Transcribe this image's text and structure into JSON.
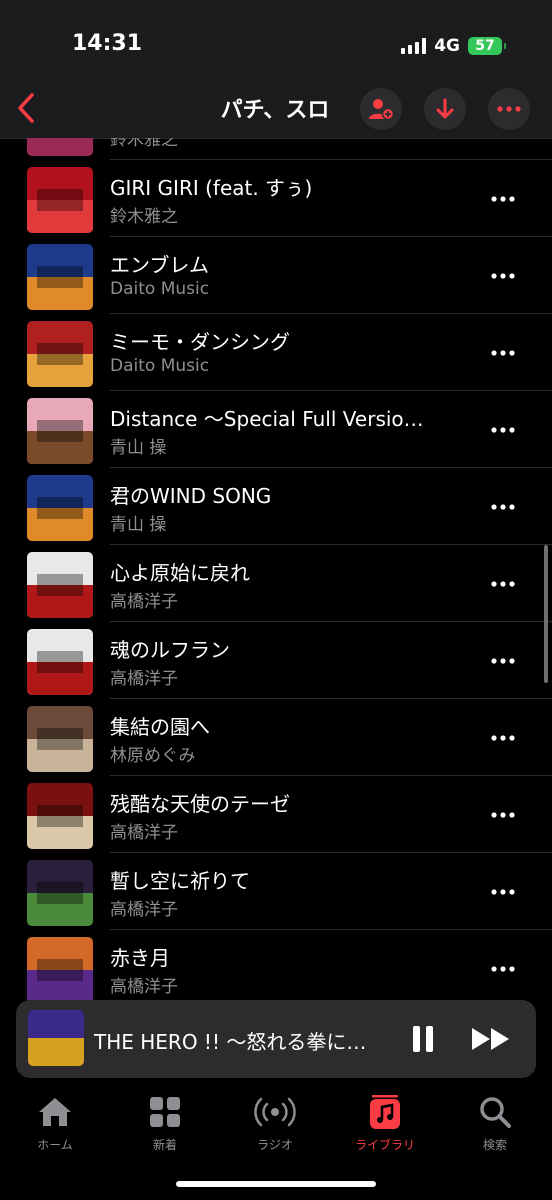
{
  "status": {
    "time": "14:31",
    "network": "4G",
    "battery": "57"
  },
  "nav": {
    "title": "パチ、スロ",
    "back_icon": "chevron-left-icon",
    "accent": "#fc3c44"
  },
  "tracks": [
    {
      "title": "",
      "artist": "鈴木雅之",
      "art_colors": [
        "#3b1640",
        "#9a2a55"
      ]
    },
    {
      "title": "GIRI GIRI (feat. すぅ)",
      "artist": "鈴木雅之",
      "art_colors": [
        "#b3121c",
        "#e23a3a"
      ]
    },
    {
      "title": "エンブレム",
      "artist": "Daito Music",
      "art_colors": [
        "#1d3b8a",
        "#e08a2a"
      ]
    },
    {
      "title": "ミーモ・ダンシング",
      "artist": "Daito Music",
      "art_colors": [
        "#b12020",
        "#e6a23c"
      ]
    },
    {
      "title": "Distance ～Special Full Versio…",
      "artist": "青山 操",
      "art_colors": [
        "#e7a8b8",
        "#7a4a2a"
      ]
    },
    {
      "title": "君のWIND SONG",
      "artist": "青山 操",
      "art_colors": [
        "#1d3b8a",
        "#e08a2a"
      ]
    },
    {
      "title": "心よ原始に戻れ",
      "artist": "高橋洋子",
      "art_colors": [
        "#e8e8e8",
        "#b01818"
      ]
    },
    {
      "title": "魂のルフラン",
      "artist": "高橋洋子",
      "art_colors": [
        "#e8e8e8",
        "#b01818"
      ]
    },
    {
      "title": "集結の園へ",
      "artist": "林原めぐみ",
      "art_colors": [
        "#6b4a3a",
        "#c9b49a"
      ]
    },
    {
      "title": "残酷な天使のテーゼ",
      "artist": "高橋洋子",
      "art_colors": [
        "#7a1010",
        "#d8c8a8"
      ]
    },
    {
      "title": "暫し空に祈りて",
      "artist": "高橋洋子",
      "art_colors": [
        "#2a1f3a",
        "#4a8a3a"
      ]
    },
    {
      "title": "赤き月",
      "artist": "高橋洋子",
      "art_colors": [
        "#d46a2a",
        "#5a2a8a"
      ]
    }
  ],
  "now_playing": {
    "title": "THE HERO !! ～怒れる拳に…",
    "art_colors": [
      "#3a2a8a",
      "#d8a020"
    ]
  },
  "tabs": [
    {
      "label": "ホーム",
      "icon": "home-icon"
    },
    {
      "label": "新着",
      "icon": "grid-icon"
    },
    {
      "label": "ラジオ",
      "icon": "radio-icon"
    },
    {
      "label": "ライブラリ",
      "icon": "library-icon",
      "active": true
    },
    {
      "label": "検索",
      "icon": "search-icon"
    }
  ]
}
